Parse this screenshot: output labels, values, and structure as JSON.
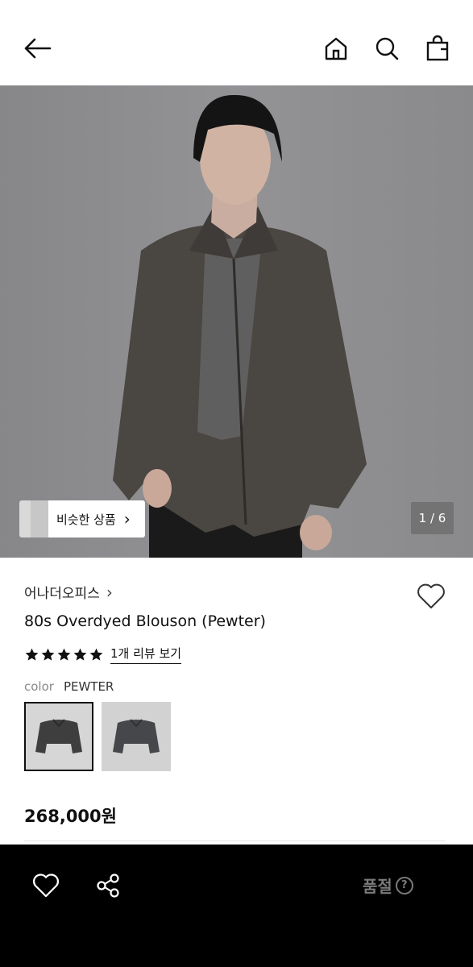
{
  "header": {
    "icons": [
      "back-arrow-icon",
      "home-icon",
      "search-icon",
      "shopping-bag-icon"
    ]
  },
  "gallery": {
    "similar_label": "비슷한 상품",
    "similar_chevron": "›",
    "counter": "1 / 6"
  },
  "product": {
    "brand": "어나더오피스",
    "brand_chevron": "›",
    "name": "80s Overdyed Blouson (Pewter)",
    "rating": 5,
    "review_link": "1개 리뷰 보기",
    "color_label": "color",
    "color_value": "PEWTER",
    "price": "268,000원"
  },
  "bottom_bar": {
    "status": "품절",
    "help_glyph": "?"
  }
}
